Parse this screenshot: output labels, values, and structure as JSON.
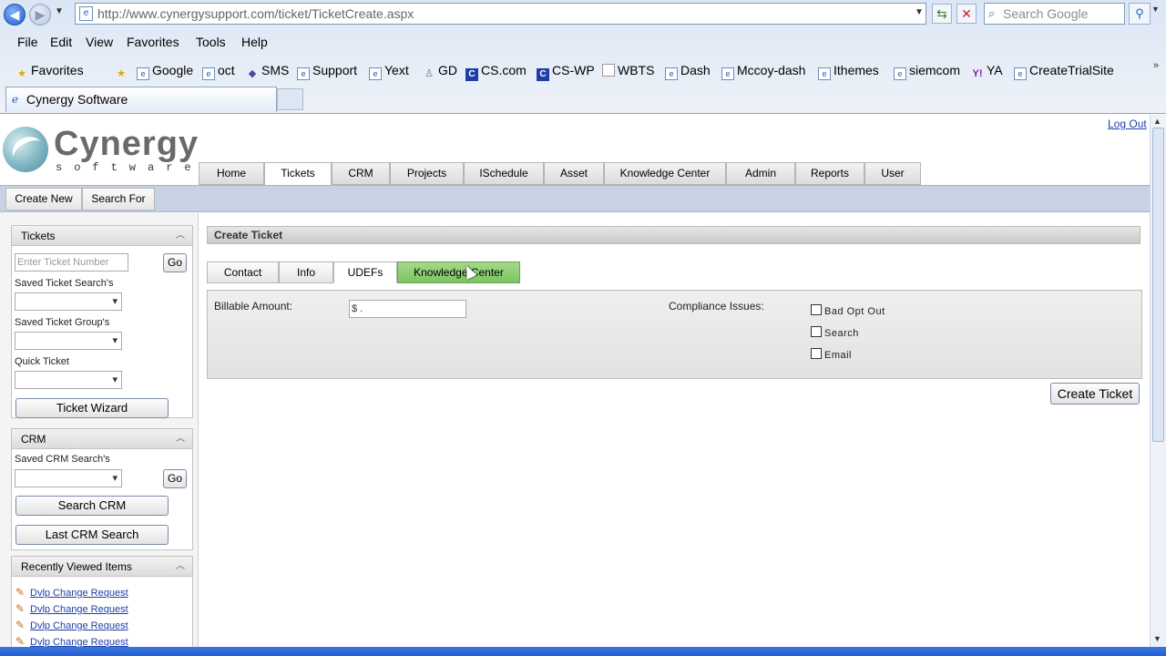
{
  "browser": {
    "url": "http://www.cynergysupport.com/ticket/TicketCreate.aspx",
    "search_placeholder": "Search Google",
    "menu": [
      "File",
      "Edit",
      "View",
      "Favorites",
      "Tools",
      "Help"
    ],
    "favorites_label": "Favorites",
    "favorites": [
      {
        "label": "Google",
        "icon": "e"
      },
      {
        "label": "oct",
        "icon": "e"
      },
      {
        "label": "SMS",
        "icon": "diamond"
      },
      {
        "label": "Support",
        "icon": "e"
      },
      {
        "label": "Yext",
        "icon": "e"
      },
      {
        "label": "GD",
        "icon": "gd"
      },
      {
        "label": "CS.com",
        "icon": "c"
      },
      {
        "label": "CS-WP",
        "icon": "c"
      },
      {
        "label": "WBTS",
        "icon": "page"
      },
      {
        "label": "Dash",
        "icon": "e"
      },
      {
        "label": "Mccoy-dash",
        "icon": "e"
      },
      {
        "label": "Ithemes",
        "icon": "e"
      },
      {
        "label": "siemcom",
        "icon": "e"
      },
      {
        "label": "YA",
        "icon": "y"
      },
      {
        "label": "CreateTrialSite",
        "icon": "e"
      }
    ],
    "tab_title": "Cynergy Software"
  },
  "app": {
    "logo_name": "Cynergy",
    "logo_sub": "software",
    "logout": "Log Out",
    "main_tabs": [
      "Home",
      "Tickets",
      "CRM",
      "Projects",
      "ISchedule",
      "Asset",
      "Knowledge Center",
      "Admin",
      "Reports",
      "User"
    ],
    "active_main_tab": "Tickets",
    "toolbar": {
      "create_new": "Create New",
      "search_for": "Search For"
    }
  },
  "sidebar": {
    "tickets": {
      "title": "Tickets",
      "ticket_number_placeholder": "Enter Ticket Number",
      "go": "Go",
      "saved_search_label": "Saved Ticket Search's",
      "saved_group_label": "Saved Ticket Group's",
      "quick_label": "Quick Ticket",
      "wizard": "Ticket Wizard"
    },
    "crm": {
      "title": "CRM",
      "saved_search_label": "Saved CRM Search's",
      "go": "Go",
      "search": "Search CRM",
      "last_search": "Last CRM Search"
    },
    "recent": {
      "title": "Recently Viewed Items",
      "items": [
        "Dvlp Change Request",
        "Dvlp Change Request",
        "Dvlp Change Request",
        "Dvlp Change Request"
      ]
    }
  },
  "main": {
    "section_title": "Create Ticket",
    "tabs": [
      "Contact",
      "Info",
      "UDEFs",
      "Knowledge Center"
    ],
    "active_tab": "UDEFs",
    "billable_label": "Billable Amount:",
    "billable_value": "$   .",
    "compliance_label": "Compliance Issues:",
    "compliance_options": [
      {
        "label": "Bad Opt Out",
        "checked": false
      },
      {
        "label": "Search",
        "checked": false
      },
      {
        "label": "Email",
        "checked": false
      }
    ],
    "create_button": "Create Ticket"
  },
  "colors": {
    "toolbar_bg": "#c8d2e5",
    "highlight_tab": "#7cc463",
    "link": "#1f3fa8"
  }
}
